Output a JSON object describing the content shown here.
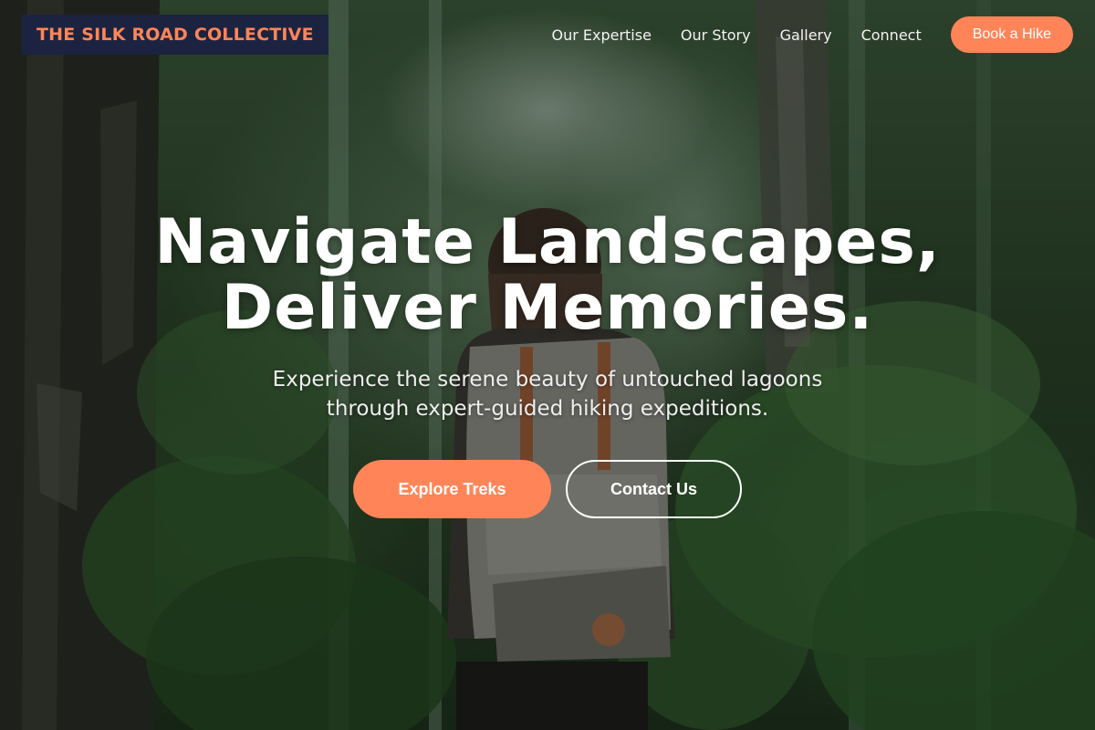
{
  "brand": {
    "name": "THE SILK ROAD COLLECTIVE",
    "accent": "#ff8559",
    "logo_bg": "#1b2340"
  },
  "nav": {
    "links": [
      "Our Expertise",
      "Our Story",
      "Gallery",
      "Connect"
    ],
    "cta_label": "Book a Hike"
  },
  "hero": {
    "background_icon": "forest-hiker-photo",
    "headline_lines": [
      "Navigate Landscapes,",
      "Deliver Memories."
    ],
    "subhead_lines": [
      "Experience the serene beauty of untouched lagoons",
      "through expert-guided hiking expeditions."
    ],
    "primary_cta": "Explore Treks",
    "secondary_cta": "Contact Us"
  }
}
